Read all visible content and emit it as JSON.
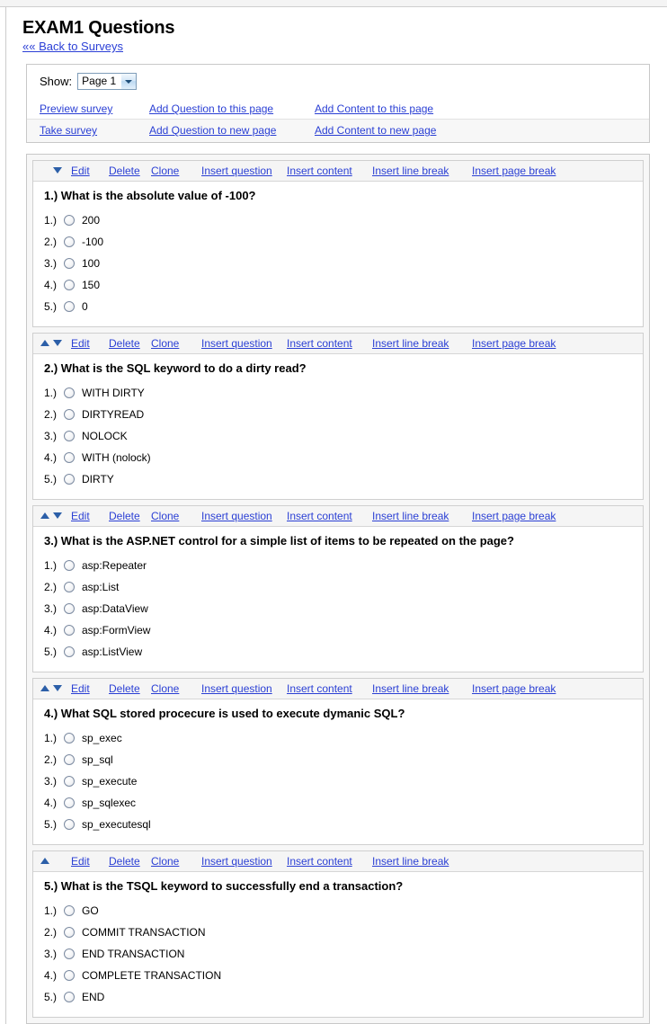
{
  "page": {
    "title": "EXAM1 Questions",
    "back_link": "«« Back to Surveys"
  },
  "toolbar": {
    "show_label": "Show:",
    "page_select_value": "Page 1",
    "page_select_options": [
      "Page 1"
    ],
    "links": {
      "preview_survey": "Preview survey",
      "take_survey": "Take survey",
      "add_question_this_page": "Add Question to this page",
      "add_question_new_page": "Add Question to new page",
      "add_content_this_page": "Add Content to this page",
      "add_content_new_page": "Add Content to new page"
    }
  },
  "header_actions": {
    "edit": "Edit",
    "delete": "Delete",
    "clone": "Clone",
    "insert_question": "Insert question",
    "insert_content": "Insert content",
    "insert_line_break": "Insert line break",
    "insert_page_break": "Insert page break"
  },
  "colors": {
    "link": "#2a3fd4",
    "delete_link": "#d82020",
    "arrow": "#2c5fa8",
    "header_bg": "#f5f5f5",
    "panel_border": "#c8c8c8"
  },
  "questions": [
    {
      "number": "1.)",
      "text": "1.) What is the absolute value of -100?",
      "move_up": false,
      "move_down": true,
      "has_page_break": true,
      "answers": [
        {
          "num": "1.)",
          "text": "200"
        },
        {
          "num": "2.)",
          "text": "-100"
        },
        {
          "num": "3.)",
          "text": "100"
        },
        {
          "num": "4.)",
          "text": "150"
        },
        {
          "num": "5.)",
          "text": "0"
        }
      ]
    },
    {
      "number": "2.)",
      "text": "2.) What is the SQL keyword to do a dirty read?",
      "move_up": true,
      "move_down": true,
      "has_page_break": true,
      "answers": [
        {
          "num": "1.)",
          "text": "WITH DIRTY"
        },
        {
          "num": "2.)",
          "text": "DIRTYREAD"
        },
        {
          "num": "3.)",
          "text": "NOLOCK"
        },
        {
          "num": "4.)",
          "text": "WITH (nolock)"
        },
        {
          "num": "5.)",
          "text": "DIRTY"
        }
      ]
    },
    {
      "number": "3.)",
      "text": "3.) What is the ASP.NET control for a simple list of items to be repeated on the page?",
      "move_up": true,
      "move_down": true,
      "has_page_break": true,
      "answers": [
        {
          "num": "1.)",
          "text": "asp:Repeater"
        },
        {
          "num": "2.)",
          "text": "asp:List"
        },
        {
          "num": "3.)",
          "text": "asp:DataView"
        },
        {
          "num": "4.)",
          "text": "asp:FormView"
        },
        {
          "num": "5.)",
          "text": "asp:ListView"
        }
      ]
    },
    {
      "number": "4.)",
      "text": "4.) What SQL stored procecure is used to execute dymanic SQL?",
      "move_up": true,
      "move_down": true,
      "has_page_break": true,
      "answers": [
        {
          "num": "1.)",
          "text": "sp_exec"
        },
        {
          "num": "2.)",
          "text": "sp_sql"
        },
        {
          "num": "3.)",
          "text": "sp_execute"
        },
        {
          "num": "4.)",
          "text": "sp_sqlexec"
        },
        {
          "num": "5.)",
          "text": "sp_executesql"
        }
      ]
    },
    {
      "number": "5.)",
      "text": "5.) What is the TSQL keyword to successfully end a transaction?",
      "move_up": true,
      "move_down": false,
      "has_page_break": false,
      "answers": [
        {
          "num": "1.)",
          "text": "GO"
        },
        {
          "num": "2.)",
          "text": "COMMIT TRANSACTION"
        },
        {
          "num": "3.)",
          "text": "END TRANSACTION"
        },
        {
          "num": "4.)",
          "text": "COMPLETE TRANSACTION"
        },
        {
          "num": "5.)",
          "text": "END"
        }
      ]
    }
  ]
}
